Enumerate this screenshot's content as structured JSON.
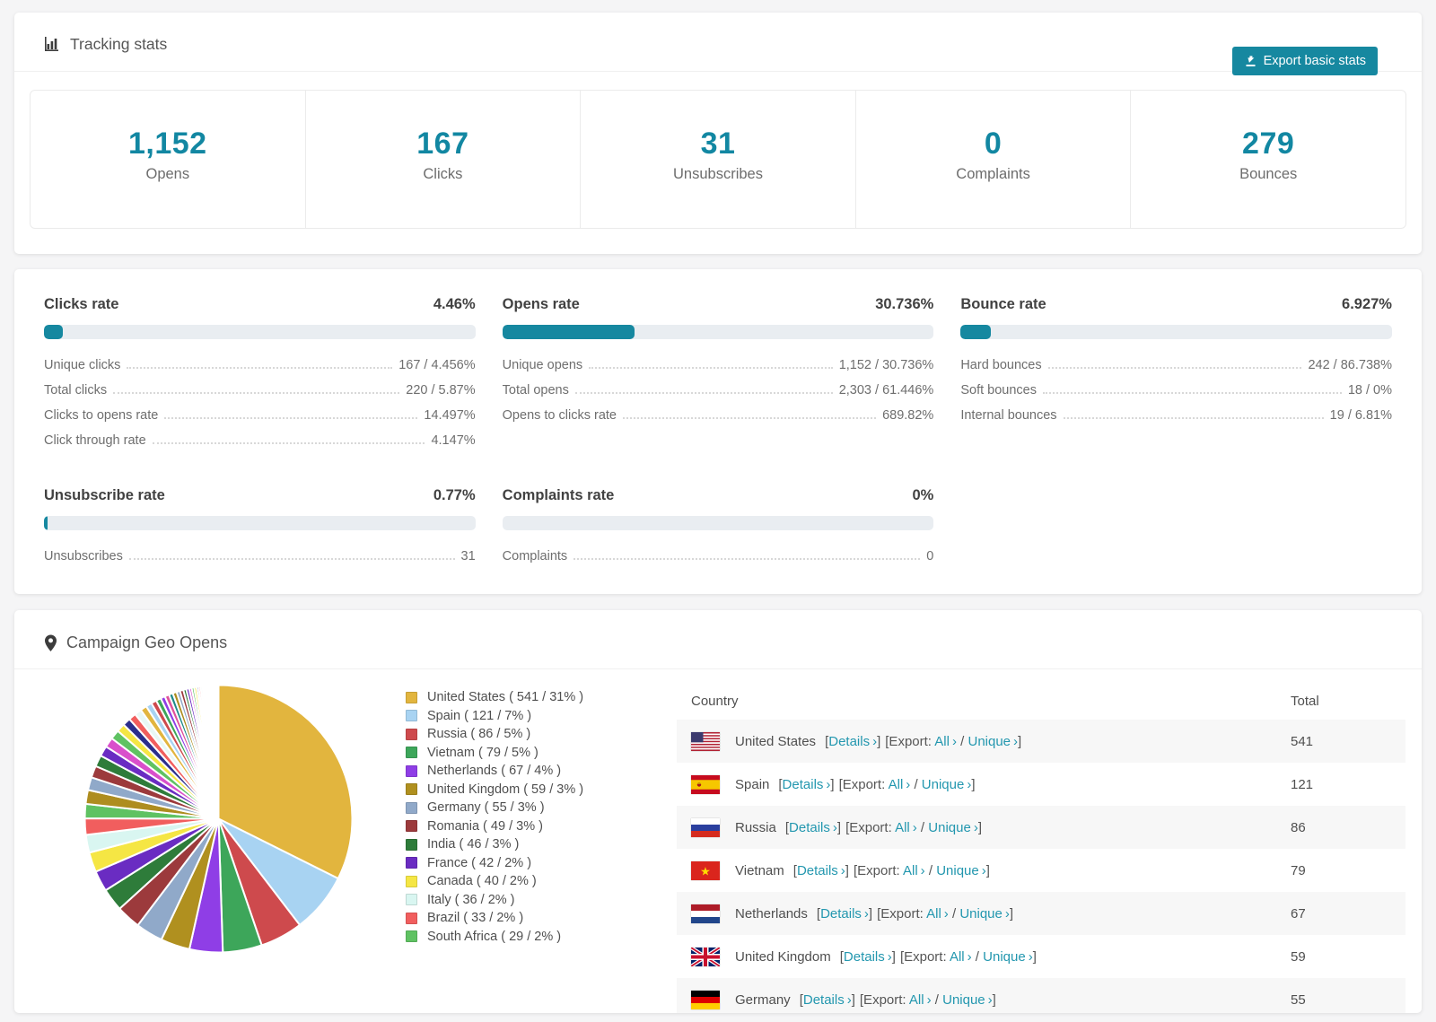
{
  "accent": "#1688a0",
  "tracking": {
    "title": "Tracking stats",
    "export_button": "Export basic stats",
    "stats": [
      {
        "value": "1,152",
        "label": "Opens"
      },
      {
        "value": "167",
        "label": "Clicks"
      },
      {
        "value": "31",
        "label": "Unsubscribes"
      },
      {
        "value": "0",
        "label": "Complaints"
      },
      {
        "value": "279",
        "label": "Bounces"
      }
    ]
  },
  "rates": {
    "columns": [
      {
        "title": "Clicks rate",
        "value": "4.46%",
        "percent": 4.46,
        "rows": [
          {
            "label": "Unique clicks",
            "value": "167 / 4.456%"
          },
          {
            "label": "Total clicks",
            "value": "220 / 5.87%"
          },
          {
            "label": "Clicks to opens rate",
            "value": "14.497%"
          },
          {
            "label": "Click through rate",
            "value": "4.147%"
          }
        ]
      },
      {
        "title": "Opens rate",
        "value": "30.736%",
        "percent": 30.736,
        "rows": [
          {
            "label": "Unique opens",
            "value": "1,152 / 30.736%"
          },
          {
            "label": "Total opens",
            "value": "2,303 / 61.446%"
          },
          {
            "label": "Opens to clicks rate",
            "value": "689.82%"
          }
        ]
      },
      {
        "title": "Bounce rate",
        "value": "6.927%",
        "percent": 6.927,
        "rows": [
          {
            "label": "Hard bounces",
            "value": "242 / 86.738%"
          },
          {
            "label": "Soft bounces",
            "value": "18 / 0%"
          },
          {
            "label": "Internal bounces",
            "value": "19 / 6.81%"
          }
        ]
      },
      {
        "title": "Unsubscribe rate",
        "value": "0.77%",
        "percent": 0.77,
        "rows": [
          {
            "label": "Unsubscribes",
            "value": "31"
          }
        ]
      },
      {
        "title": "Complaints rate",
        "value": "0%",
        "percent": 0,
        "rows": [
          {
            "label": "Complaints",
            "value": "0"
          }
        ]
      }
    ]
  },
  "geo": {
    "title": "Campaign Geo Opens",
    "table": {
      "headers": [
        "Country",
        "Total"
      ],
      "links": {
        "details": "Details",
        "export": "Export:",
        "all": "All",
        "unique": "Unique"
      },
      "rows": [
        {
          "country": "United States",
          "flag": "us",
          "total": "541"
        },
        {
          "country": "Spain",
          "flag": "es",
          "total": "121"
        },
        {
          "country": "Russia",
          "flag": "ru",
          "total": "86"
        },
        {
          "country": "Vietnam",
          "flag": "vn",
          "total": "79"
        },
        {
          "country": "Netherlands",
          "flag": "nl",
          "total": "67"
        },
        {
          "country": "United Kingdom",
          "flag": "gb",
          "total": "59"
        },
        {
          "country": "Germany",
          "flag": "de",
          "total": "55"
        }
      ]
    }
  },
  "chart_data": {
    "type": "pie",
    "title": "Campaign Geo Opens",
    "legend_position": "right",
    "start_angle": 0,
    "direction": "clockwise",
    "series": [
      {
        "label": "United States",
        "value": 541,
        "pct": "31%",
        "color": "#e2b53e",
        "legend": "United States ( 541 / 31% )"
      },
      {
        "label": "Spain",
        "value": 121,
        "pct": "7%",
        "color": "#a8d3f2",
        "legend": "Spain ( 121 / 7% )"
      },
      {
        "label": "Russia",
        "value": 86,
        "pct": "5%",
        "color": "#ce4a4d",
        "legend": "Russia ( 86 / 5% )"
      },
      {
        "label": "Vietnam",
        "value": 79,
        "pct": "5%",
        "color": "#3da65a",
        "legend": "Vietnam ( 79 / 5% )"
      },
      {
        "label": "Netherlands",
        "value": 67,
        "pct": "4%",
        "color": "#8f3ee6",
        "legend": "Netherlands ( 67 / 4% )"
      },
      {
        "label": "United Kingdom",
        "value": 59,
        "pct": "3%",
        "color": "#b0901f",
        "legend": "United Kingdom ( 59 / 3% )"
      },
      {
        "label": "Germany",
        "value": 55,
        "pct": "3%",
        "color": "#90a9c9",
        "legend": "Germany ( 55 / 3% )"
      },
      {
        "label": "Romania",
        "value": 49,
        "pct": "3%",
        "color": "#9c3a3c",
        "legend": "Romania ( 49 / 3% )"
      },
      {
        "label": "India",
        "value": 46,
        "pct": "3%",
        "color": "#2e7c3a",
        "legend": "India ( 46 / 3% )"
      },
      {
        "label": "France",
        "value": 42,
        "pct": "2%",
        "color": "#6a2cc2",
        "legend": "France ( 42 / 2% )"
      },
      {
        "label": "Canada",
        "value": 40,
        "pct": "2%",
        "color": "#f5e644",
        "legend": "Canada ( 40 / 2% )"
      },
      {
        "label": "Italy",
        "value": 36,
        "pct": "2%",
        "color": "#d9f6f1",
        "legend": "Italy ( 36 / 2% )"
      },
      {
        "label": "Brazil",
        "value": 33,
        "pct": "2%",
        "color": "#f15e5e",
        "legend": "Brazil ( 33 / 2% )"
      },
      {
        "label": "South Africa",
        "value": 29,
        "pct": "2%",
        "color": "#5fc262",
        "legend": "South Africa ( 29 / 2% )"
      }
    ],
    "others_values": [
      28,
      26,
      24,
      23,
      21,
      20,
      19,
      17,
      16,
      15,
      14,
      13,
      12,
      11,
      10,
      9,
      9,
      8,
      8,
      7,
      7,
      6,
      6,
      5,
      5,
      5,
      4,
      4,
      4,
      3,
      3,
      3,
      3,
      2,
      2,
      2,
      2,
      2,
      1,
      1,
      1,
      1,
      1,
      1,
      1,
      1,
      1,
      1
    ],
    "others_palette": [
      "#ae8d1f",
      "#90a9c9",
      "#9c3a3c",
      "#2e7c3a",
      "#6a2cc2",
      "#d94fcb",
      "#5fc262",
      "#f5e644",
      "#2b2e8c",
      "#f15e5e",
      "#e8f8f5",
      "#e2b53e",
      "#a8d3f2",
      "#ce4a4d",
      "#3da65a",
      "#8f3ee6",
      "#e0529c",
      "#1f8a8a"
    ]
  }
}
